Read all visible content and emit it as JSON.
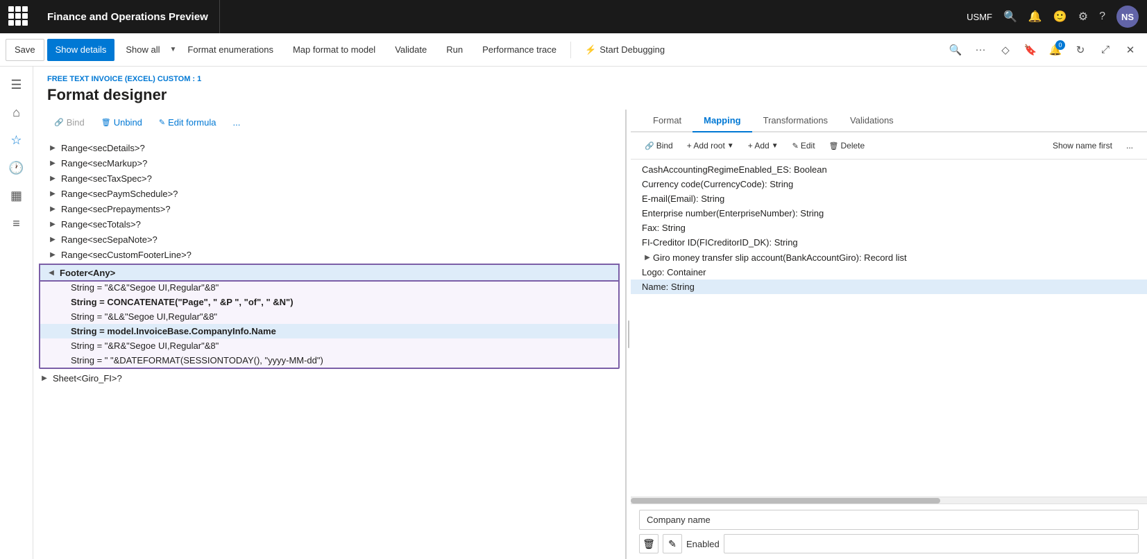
{
  "app": {
    "title": "Finance and Operations Preview",
    "env": "USMF",
    "avatar": "NS"
  },
  "toolbar": {
    "save_label": "Save",
    "show_details_label": "Show details",
    "show_all_label": "Show all",
    "format_enumerations_label": "Format enumerations",
    "map_format_to_model_label": "Map format to model",
    "validate_label": "Validate",
    "run_label": "Run",
    "performance_trace_label": "Performance trace",
    "start_debugging_label": "Start Debugging"
  },
  "page": {
    "breadcrumb": "FREE TEXT INVOICE (EXCEL) CUSTOM : 1",
    "title": "Format designer"
  },
  "action_bar": {
    "bind_label": "Bind",
    "unbind_label": "Unbind",
    "edit_formula_label": "Edit formula",
    "more_label": "..."
  },
  "mapping_tabs": [
    {
      "id": "format",
      "label": "Format"
    },
    {
      "id": "mapping",
      "label": "Mapping"
    },
    {
      "id": "transformations",
      "label": "Transformations"
    },
    {
      "id": "validations",
      "label": "Validations"
    }
  ],
  "mapping_toolbar": {
    "bind_label": "Bind",
    "add_root_label": "+ Add root",
    "add_label": "+ Add",
    "edit_label": "Edit",
    "delete_label": "Delete",
    "show_name_first_label": "Show name first",
    "more_label": "..."
  },
  "tree_items": [
    {
      "id": "secDetails",
      "label": "Range<secDetails>?",
      "indent": 20,
      "hasToggle": true,
      "expanded": false
    },
    {
      "id": "secMarkup",
      "label": "Range<secMarkup>?",
      "indent": 20,
      "hasToggle": true,
      "expanded": false
    },
    {
      "id": "secTaxSpec",
      "label": "Range<secTaxSpec>?",
      "indent": 20,
      "hasToggle": true,
      "expanded": false
    },
    {
      "id": "secPaymSchedule",
      "label": "Range<secPaymSchedule>?",
      "indent": 20,
      "hasToggle": true,
      "expanded": false
    },
    {
      "id": "secPrepayments",
      "label": "Range<secPrepayments>?",
      "indent": 20,
      "hasToggle": true,
      "expanded": false
    },
    {
      "id": "secTotals",
      "label": "Range<secTotals>?",
      "indent": 20,
      "hasToggle": true,
      "expanded": false
    },
    {
      "id": "secSepaNote",
      "label": "Range<secSepaNote>?",
      "indent": 20,
      "hasToggle": true,
      "expanded": false
    },
    {
      "id": "secCustomFooterLine",
      "label": "Range<secCustomFooterLine>?",
      "indent": 20,
      "hasToggle": true,
      "expanded": false
    }
  ],
  "footer_group": {
    "header": {
      "id": "footerAny",
      "label": "Footer<Any>",
      "indent": 8,
      "hasToggle": true,
      "expanded": true,
      "selected": true
    },
    "children": [
      {
        "id": "str1",
        "label": "String = \"&C&\"Segoe UI,Regular\"&8\"",
        "indent": 40,
        "bold": false
      },
      {
        "id": "str2",
        "label": "String = CONCATENATE(\"Page\", \" &P \", \"of\", \" &N\")",
        "indent": 40,
        "bold": true
      },
      {
        "id": "str3",
        "label": "String = \"&L&\"Segoe UI,Regular\"&8\"",
        "indent": 40,
        "bold": false
      },
      {
        "id": "str4",
        "label": "String = model.InvoiceBase.CompanyInfo.Name",
        "indent": 40,
        "bold": true,
        "selected": true
      },
      {
        "id": "str5",
        "label": "String = \"&R&\"Segoe UI,Regular\"&8\"",
        "indent": 40,
        "bold": false
      },
      {
        "id": "str6",
        "label": "String = \" \"&DATEFORMAT(SESSIONTODAY(), \"yyyy-MM-dd\")",
        "indent": 40,
        "bold": false
      }
    ]
  },
  "after_tree": [
    {
      "id": "sheetGiroFI",
      "label": "Sheet<Giro_FI>?",
      "indent": 8,
      "hasToggle": true
    }
  ],
  "mapping_items": [
    {
      "id": "cashAccounting",
      "label": "CashAccountingRegimeEnabled_ES: Boolean",
      "indent": 0
    },
    {
      "id": "currencyCode",
      "label": "Currency code(CurrencyCode): String",
      "indent": 0
    },
    {
      "id": "email",
      "label": "E-mail(Email): String",
      "indent": 0
    },
    {
      "id": "enterpriseNumber",
      "label": "Enterprise number(EnterpriseNumber): String",
      "indent": 0
    },
    {
      "id": "fax",
      "label": "Fax: String",
      "indent": 0
    },
    {
      "id": "fiCreditor",
      "label": "FI-Creditor ID(FICreditorID_DK): String",
      "indent": 0
    },
    {
      "id": "giro",
      "label": "Giro money transfer slip account(BankAccountGiro): Record list",
      "indent": 0,
      "hasToggle": true
    },
    {
      "id": "logo",
      "label": "Logo: Container",
      "indent": 0
    },
    {
      "id": "name",
      "label": "Name: String",
      "indent": 0,
      "selected": true
    }
  ],
  "mapping_detail": {
    "input_value": "Company name",
    "enabled_label": "Enabled",
    "delete_icon": "🗑",
    "edit_icon": "✎"
  },
  "sidebar_icons": [
    {
      "id": "home",
      "icon": "⌂",
      "label": "Home"
    },
    {
      "id": "favorites",
      "icon": "☆",
      "label": "Favorites"
    },
    {
      "id": "recent",
      "icon": "🕐",
      "label": "Recent"
    },
    {
      "id": "workspaces",
      "icon": "▦",
      "label": "Workspaces"
    },
    {
      "id": "list",
      "icon": "☰",
      "label": "List"
    }
  ]
}
